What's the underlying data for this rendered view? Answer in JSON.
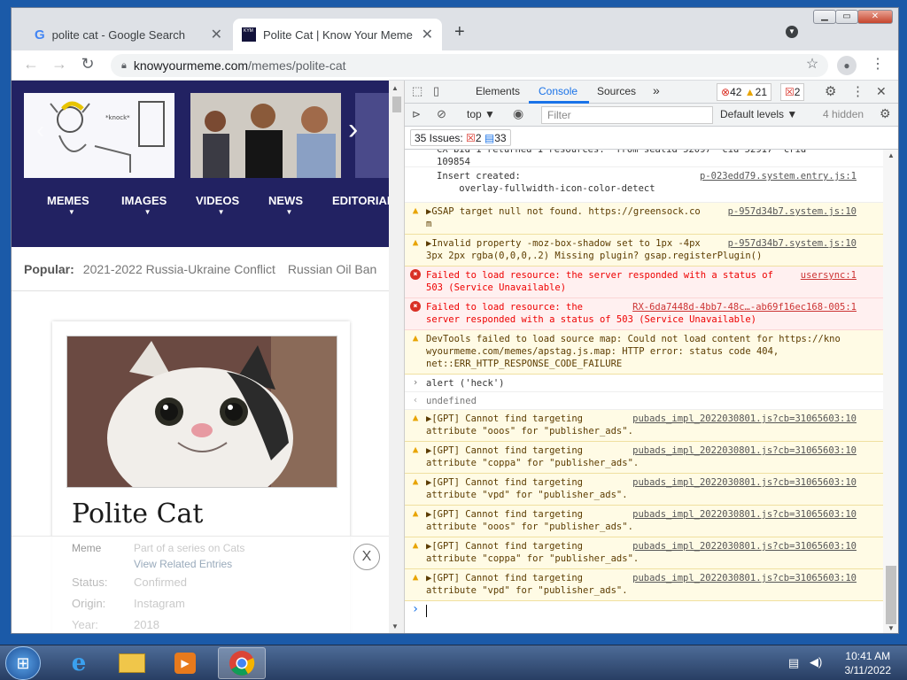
{
  "browser": {
    "tabs": [
      {
        "title": "polite cat - Google Search",
        "icon": "google-icon"
      },
      {
        "title": "Polite Cat | Know Your Meme",
        "icon": "kym-icon"
      }
    ],
    "url": {
      "host": "knowyourmeme.com",
      "path": "/memes/polite-cat"
    }
  },
  "page": {
    "menu": [
      "MEMES",
      "IMAGES",
      "VIDEOS",
      "NEWS",
      "EDITORIAL"
    ],
    "popular_label": "Popular:",
    "popular_items": [
      "2021-2022 Russia-Ukraine Conflict",
      "Russian Oil Ban"
    ],
    "title": "Polite Cat",
    "meta": {
      "type_label": "Meme",
      "series": "Part of a series on Cats",
      "related": "View Related Entries",
      "status_label": "Status:",
      "status": "Confirmed",
      "origin_label": "Origin:",
      "origin": "Instagram",
      "year_label": "Year:",
      "year": "2018"
    },
    "close_label": "X"
  },
  "devtools": {
    "tabs": [
      "Elements",
      "Console",
      "Sources"
    ],
    "counts": {
      "errors": "42",
      "warnings": "21",
      "issues": "2"
    },
    "context": "top",
    "filter_placeholder": "Filter",
    "levels": "Default levels",
    "hidden": "4 hidden",
    "issues_label": "35 Issues:",
    "issues_err": "2",
    "issues_info": "33",
    "log": [
      {
        "kind": "plain",
        "lines": [
          "CX bid 1 returned 1 resources.  from seatid 52097  cid 52917  crid",
          "109854"
        ],
        "src": ""
      },
      {
        "kind": "plain",
        "lines": [
          "Insert created:",
          "    overlay-fullwidth-icon-color-detect"
        ],
        "src": "p-023edd79.system.entry.js:1"
      },
      {
        "kind": "warn",
        "lines": [
          "▶GSAP target null not found. https://greensock.co",
          "m"
        ],
        "src": "p-957d34b7.system.js:10"
      },
      {
        "kind": "warn",
        "lines": [
          "▶Invalid property -moz-box-shadow set to 1px -4px",
          "3px 2px rgba(0,0,0,.2) Missing plugin? gsap.registerPlugin()"
        ],
        "src": "p-957d34b7.system.js:10"
      },
      {
        "kind": "err",
        "lines": [
          "Failed to load resource: the server responded with a status of",
          "503 (Service Unavailable)"
        ],
        "src": "usersync:1"
      },
      {
        "kind": "err",
        "lines": [
          "Failed to load resource: the",
          "server responded with a status of 503 (Service Unavailable)"
        ],
        "src": "RX-6da7448d-4bb7-48c…-ab69f16ec168-005:1"
      },
      {
        "kind": "warn",
        "lines": [
          "DevTools failed to load source map: Could not load content for https://kno",
          "wyourmeme.com/memes/apstag.js.map: HTTP error: status code 404,",
          "net::ERR_HTTP_RESPONSE_CODE_FAILURE"
        ],
        "src": ""
      },
      {
        "kind": "input",
        "lines": [
          "alert ('heck')"
        ],
        "src": ""
      },
      {
        "kind": "result",
        "lines": [
          "undefined"
        ],
        "src": ""
      },
      {
        "kind": "warn",
        "lines": [
          "▶[GPT] Cannot find targeting",
          "attribute \"ooos\" for \"publisher_ads\"."
        ],
        "src": "pubads_impl_2022030801.js?cb=31065603:10"
      },
      {
        "kind": "warn",
        "lines": [
          "▶[GPT] Cannot find targeting",
          "attribute \"coppa\" for \"publisher_ads\"."
        ],
        "src": "pubads_impl_2022030801.js?cb=31065603:10"
      },
      {
        "kind": "warn",
        "lines": [
          "▶[GPT] Cannot find targeting",
          "attribute \"vpd\" for \"publisher_ads\"."
        ],
        "src": "pubads_impl_2022030801.js?cb=31065603:10"
      },
      {
        "kind": "warn",
        "lines": [
          "▶[GPT] Cannot find targeting",
          "attribute \"ooos\" for \"publisher_ads\"."
        ],
        "src": "pubads_impl_2022030801.js?cb=31065603:10"
      },
      {
        "kind": "warn",
        "lines": [
          "▶[GPT] Cannot find targeting",
          "attribute \"coppa\" for \"publisher_ads\"."
        ],
        "src": "pubads_impl_2022030801.js?cb=31065603:10"
      },
      {
        "kind": "warn",
        "lines": [
          "▶[GPT] Cannot find targeting",
          "attribute \"vpd\" for \"publisher_ads\"."
        ],
        "src": "pubads_impl_2022030801.js?cb=31065603:10"
      }
    ]
  },
  "taskbar": {
    "time": "10:41 AM",
    "date": "3/11/2022"
  }
}
